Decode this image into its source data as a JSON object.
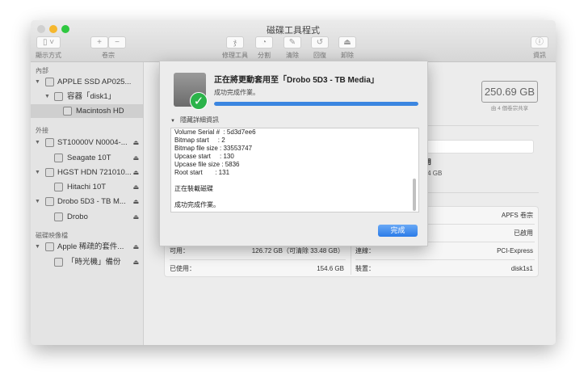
{
  "window": {
    "title": "磁碟工具程式"
  },
  "toolbar": {
    "view": "顯示方式",
    "volume": "卷宗",
    "plus": "+",
    "minus": "−",
    "firstaid": "修理工具",
    "partition": "分割",
    "erase": "清除",
    "restore": "回復",
    "unmount": "卸除",
    "info": "資訊"
  },
  "sidebar": {
    "internal": "內部",
    "external": "外接",
    "images": "磁碟映像檔",
    "items": [
      {
        "label": "APPLE SSD AP025..."
      },
      {
        "label": "容器「disk1」"
      },
      {
        "label": "Macintosh HD"
      },
      {
        "label": "ST10000V N0004-..."
      },
      {
        "label": "Seagate 10T"
      },
      {
        "label": "HGST HDN 721010..."
      },
      {
        "label": "Hitachi 10T"
      },
      {
        "label": "Drobo 5D3 - TB M..."
      },
      {
        "label": "Drobo"
      },
      {
        "label": "Apple 稀疏的套件..."
      },
      {
        "label": "「時光機」備份"
      }
    ]
  },
  "main": {
    "capacity": "250.69 GB",
    "shared": "由 4 個卷宗共享",
    "avail_label": "可用",
    "avail_value": "3.24 GB",
    "table": {
      "left": [
        {
          "k": "可用：",
          "v": "126.72 GB（可清除 33.48 GB）"
        },
        {
          "k": "已使用：",
          "v": "154.6 GB"
        }
      ],
      "right": [
        {
          "v": "APFS 卷宗"
        },
        {
          "v": "已啟用"
        },
        {
          "k": "連線：",
          "v": "PCI-Express"
        },
        {
          "k": "裝置：",
          "v": "disk1s1"
        }
      ]
    }
  },
  "dialog": {
    "title": "正在將更動套用至「Drobo 5D3 - TB Media」",
    "status": "成功完成作業。",
    "progress": 1.0,
    "details_toggle": "隱藏詳細資訊",
    "log": [
      "Volume Serial #  : 5d3d7ee6",
      "Bitmap start     : 2",
      "Bitmap file size : 33553747",
      "Upcase start     : 130",
      "Upcase file size : 5836",
      "Root start       : 131",
      "",
      "正在裝載磁碟",
      "",
      "成功完成作業。"
    ],
    "done": "完成"
  },
  "colors": {
    "accent": "#3b86e0",
    "success": "#2bb34a"
  }
}
